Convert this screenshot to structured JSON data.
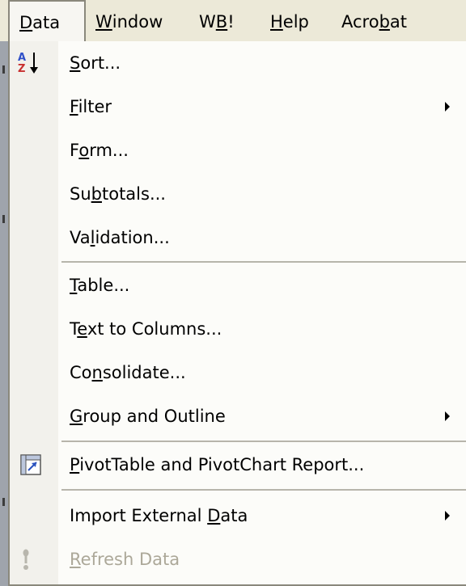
{
  "menubar": {
    "items": [
      {
        "pre": "",
        "ul": "D",
        "post": "ata"
      },
      {
        "pre": "",
        "ul": "W",
        "post": "indow"
      },
      {
        "pre": "W",
        "ul": "B",
        "post": "!"
      },
      {
        "pre": "",
        "ul": "H",
        "post": "elp"
      },
      {
        "pre": "Acro",
        "ul": "b",
        "post": "at"
      }
    ]
  },
  "menu": {
    "items": [
      {
        "pre": "",
        "ul": "S",
        "post": "ort..."
      },
      {
        "pre": "",
        "ul": "F",
        "post": "ilter"
      },
      {
        "pre": "F",
        "ul": "o",
        "post": "rm..."
      },
      {
        "pre": "Su",
        "ul": "b",
        "post": "totals..."
      },
      {
        "pre": "Va",
        "ul": "l",
        "post": "idation..."
      },
      {
        "pre": "",
        "ul": "T",
        "post": "able..."
      },
      {
        "pre": "T",
        "ul": "e",
        "post": "xt to Columns..."
      },
      {
        "pre": "Co",
        "ul": "n",
        "post": "solidate..."
      },
      {
        "pre": "",
        "ul": "G",
        "post": "roup and Outline"
      },
      {
        "pre": "",
        "ul": "P",
        "post": "ivotTable and PivotChart Report..."
      },
      {
        "pre": "Import External ",
        "ul": "D",
        "post": "ata"
      },
      {
        "pre": "",
        "ul": "R",
        "post": "efresh Data"
      }
    ]
  },
  "icons": {
    "sort": "sort-ascending-icon",
    "pivot": "pivottable-icon",
    "refresh": "refresh-exclamation-icon",
    "submenu": "submenu-arrow-icon"
  },
  "colors": {
    "menubar_bg": "#ece9d8",
    "menu_bg": "#fcfcf9",
    "gutter_bg": "#f2f1ec",
    "disabled_text": "#aca899",
    "border": "#8a887c"
  }
}
